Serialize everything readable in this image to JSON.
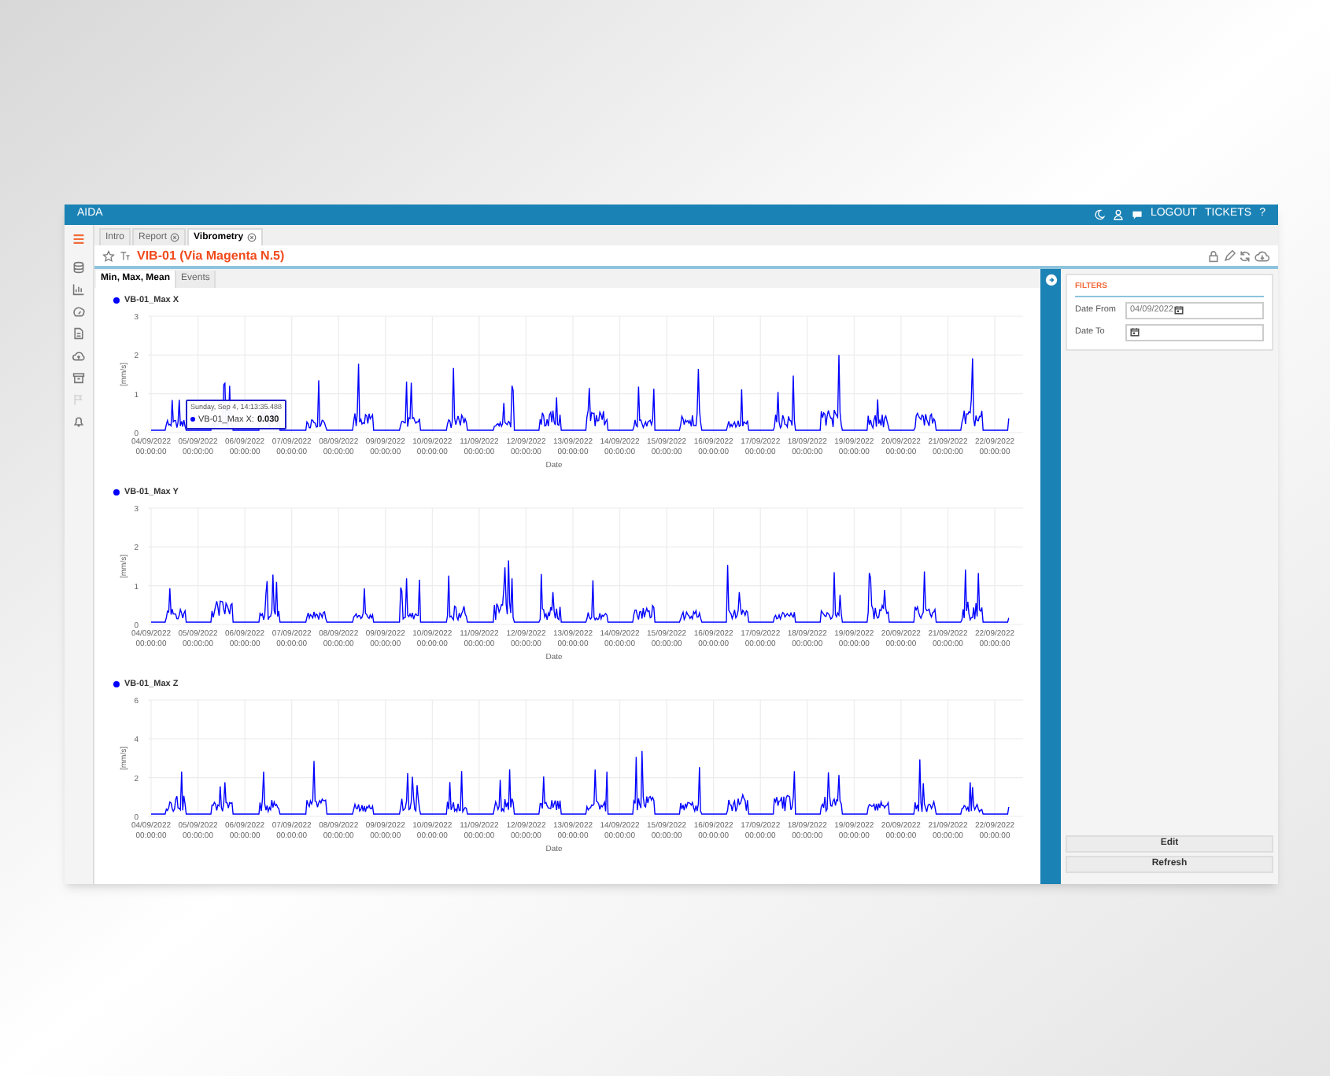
{
  "header": {
    "app_name": "AIDA",
    "links": [
      "LOGOUT",
      "TICKETS",
      "?"
    ]
  },
  "sidebar": {
    "items": [
      {
        "kind": "menu",
        "selected": true,
        "disabled": false
      },
      {
        "kind": "database",
        "selected": false,
        "disabled": false
      },
      {
        "kind": "chart",
        "selected": false,
        "disabled": false
      },
      {
        "kind": "gauge",
        "selected": false,
        "disabled": false
      },
      {
        "kind": "document",
        "selected": false,
        "disabled": false
      },
      {
        "kind": "cloud",
        "selected": false,
        "disabled": false
      },
      {
        "kind": "archive",
        "selected": false,
        "disabled": false
      },
      {
        "kind": "flag",
        "selected": false,
        "disabled": true
      },
      {
        "kind": "bell",
        "selected": false,
        "disabled": false
      }
    ]
  },
  "tabs": [
    {
      "label": "Intro",
      "selected": false,
      "closable": false
    },
    {
      "label": "Report",
      "selected": false,
      "closable": true
    },
    {
      "label": "Vibrometry",
      "selected": true,
      "closable": true
    }
  ],
  "page_title": "VIB-01 (Via Magenta N.5)",
  "subtabs": [
    {
      "label": "Min, Max, Mean",
      "selected": true
    },
    {
      "label": "Events",
      "selected": false
    }
  ],
  "charts": [
    {
      "legend": "VB-01_Max X",
      "y_label": "[mm/s]",
      "y_ticks": [
        "3",
        "2",
        "1",
        "0"
      ],
      "x_title": "Date",
      "tooltip": {
        "title": "Sunday, Sep 4, 14:13:35.488",
        "series": "VB-01_Max X:",
        "value": "0.030"
      },
      "x_labels": [
        [
          "04/09/2022",
          "00:00:00"
        ],
        [
          "05/09/2022",
          "00:00:00"
        ],
        [
          "06/09/2022",
          "00:00:00"
        ],
        [
          "07/09/2022",
          "00:00:00"
        ],
        [
          "08/09/2022",
          "00:00:00"
        ],
        [
          "09/09/2022",
          "00:00:00"
        ],
        [
          "10/09/2022",
          "00:00:00"
        ],
        [
          "11/09/2022",
          "00:00:00"
        ],
        [
          "12/09/2022",
          "00:00:00"
        ],
        [
          "13/09/2022",
          "00:00:00"
        ],
        [
          "14/09/2022",
          "00:00:00"
        ],
        [
          "15/09/2022",
          "00:00:00"
        ],
        [
          "16/09/2022",
          "00:00:00"
        ],
        [
          "17/09/2022",
          "00:00:00"
        ],
        [
          "18/09/2022",
          "00:00:00"
        ],
        [
          "19/09/2022",
          "00:00:00"
        ],
        [
          "20/09/2022",
          "00:00:00"
        ],
        [
          "21/09/2022",
          "00:00:00"
        ],
        [
          "22/09/2022",
          "00:00:00"
        ]
      ]
    },
    {
      "legend": "VB-01_Max Y",
      "y_label": "[mm/s]",
      "y_ticks": [
        "3",
        "2",
        "1",
        "0"
      ],
      "x_title": "Date",
      "x_labels": [
        [
          "04/09/2022",
          "00:00:00"
        ],
        [
          "05/09/2022",
          "00:00:00"
        ],
        [
          "06/09/2022",
          "00:00:00"
        ],
        [
          "07/09/2022",
          "00:00:00"
        ],
        [
          "08/09/2022",
          "00:00:00"
        ],
        [
          "09/09/2022",
          "00:00:00"
        ],
        [
          "10/09/2022",
          "00:00:00"
        ],
        [
          "11/09/2022",
          "00:00:00"
        ],
        [
          "12/09/2022",
          "00:00:00"
        ],
        [
          "13/09/2022",
          "00:00:00"
        ],
        [
          "14/09/2022",
          "00:00:00"
        ],
        [
          "15/09/2022",
          "00:00:00"
        ],
        [
          "16/09/2022",
          "00:00:00"
        ],
        [
          "17/09/2022",
          "00:00:00"
        ],
        [
          "18/09/2022",
          "00:00:00"
        ],
        [
          "19/09/2022",
          "00:00:00"
        ],
        [
          "20/09/2022",
          "00:00:00"
        ],
        [
          "21/09/2022",
          "00:00:00"
        ],
        [
          "22/09/2022",
          "00:00:00"
        ]
      ]
    },
    {
      "legend": "VB-01_Max Z",
      "y_label": "[mm/s]",
      "y_ticks": [
        "6",
        "4",
        "2",
        "0"
      ],
      "x_title": "Date",
      "x_labels": [
        [
          "04/09/2022",
          "00:00:00"
        ],
        [
          "05/09/2022",
          "00:00:00"
        ],
        [
          "06/09/2022",
          "00:00:00"
        ],
        [
          "07/09/2022",
          "00:00:00"
        ],
        [
          "08/09/2022",
          "00:00:00"
        ],
        [
          "09/09/2022",
          "00:00:00"
        ],
        [
          "10/09/2022",
          "00:00:00"
        ],
        [
          "11/09/2022",
          "00:00:00"
        ],
        [
          "12/09/2022",
          "00:00:00"
        ],
        [
          "13/09/2022",
          "00:00:00"
        ],
        [
          "14/09/2022",
          "00:00:00"
        ],
        [
          "15/09/2022",
          "00:00:00"
        ],
        [
          "16/09/2022",
          "00:00:00"
        ],
        [
          "17/09/2022",
          "00:00:00"
        ],
        [
          "18/09/2022",
          "00:00:00"
        ],
        [
          "19/09/2022",
          "00:00:00"
        ],
        [
          "20/09/2022",
          "00:00:00"
        ],
        [
          "21/09/2022",
          "00:00:00"
        ],
        [
          "22/09/2022",
          "00:00:00"
        ]
      ]
    }
  ],
  "filters": {
    "title": "FILTERS",
    "fields": [
      {
        "label": "Date From",
        "value": "04/09/2022"
      },
      {
        "label": "Date To"
      }
    ],
    "buttons": [
      "Edit",
      "Refresh"
    ]
  }
}
